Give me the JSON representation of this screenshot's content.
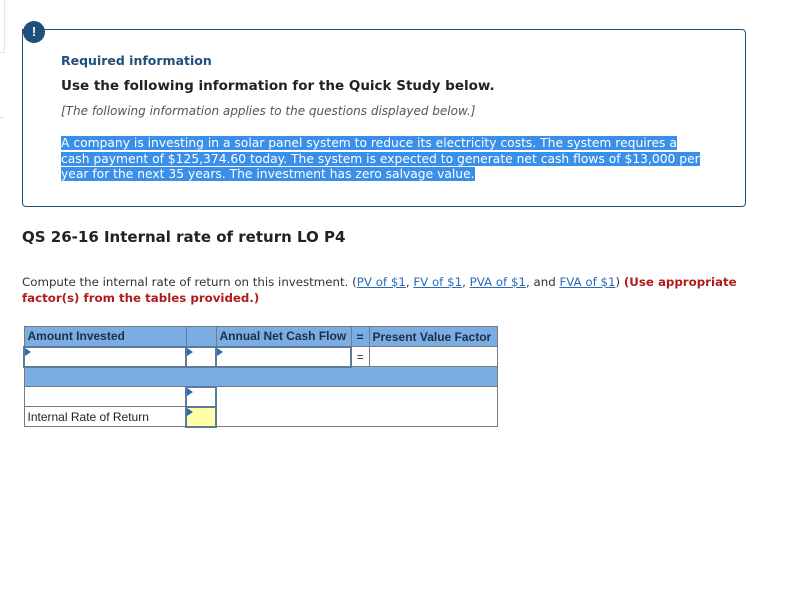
{
  "info": {
    "icon": "exclamation-icon",
    "icon_glyph": "!",
    "title": "Required information",
    "subtitle": "Use the following information for the Quick Study below.",
    "note": "[The following information applies to the questions displayed below.]",
    "body_lines": [
      "A company is investing in a solar panel system to reduce its electricity costs. The system requires a",
      "cash payment of $125,374.60 today. The system is expected to generate net cash flows of $13,000 per",
      "year for the next 35 years. The investment has zero salvage value."
    ]
  },
  "question": {
    "title": "QS 26-16 Internal rate of return LO P4",
    "instruction_prefix": "Compute the internal rate of return on this investment. (",
    "links": [
      "PV of $1",
      "FV of $1",
      "PVA of $1",
      "FVA of $1"
    ],
    "sep1": ", ",
    "sep2": ", ",
    "sep3": ", and ",
    "instruction_close": ") ",
    "emphasis": "(Use appropriate factor(s) from the tables provided.)"
  },
  "table": {
    "headers": [
      "Amount Invested",
      "",
      "Annual Net Cash Flow",
      "=",
      "Present Value Factor"
    ],
    "row1": {
      "amount_invested": "",
      "operator": "",
      "annual_net_cash_flow": "",
      "equals": "=",
      "present_value_factor": ""
    },
    "row3": {
      "label": "",
      "value": ""
    },
    "row4": {
      "label": "Internal Rate of Return",
      "value": ""
    }
  }
}
